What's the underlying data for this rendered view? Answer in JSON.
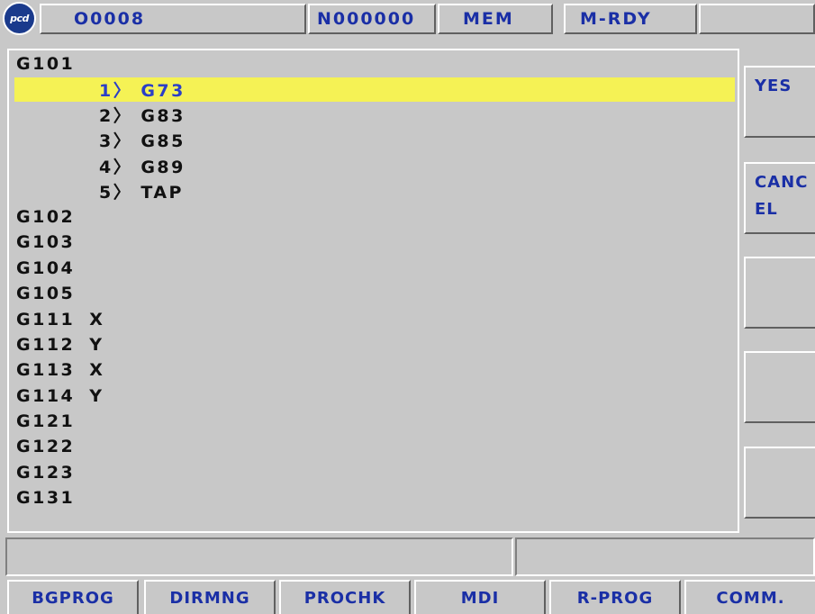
{
  "header": {
    "logo_text": "pcd",
    "program": "O0008",
    "sequence": "N000000",
    "mode": "MEM",
    "status": "M-RDY",
    "extra": ""
  },
  "list": {
    "lines": [
      {
        "code": "G101",
        "arg": ""
      },
      {
        "code": "1〉 G73",
        "arg": "",
        "selected": true
      },
      {
        "code": "2〉 G83",
        "arg": ""
      },
      {
        "code": "3〉 G85",
        "arg": ""
      },
      {
        "code": "4〉 G89",
        "arg": ""
      },
      {
        "code": "5〉 TAP",
        "arg": ""
      },
      {
        "code": "G102",
        "arg": ""
      },
      {
        "code": "G103",
        "arg": ""
      },
      {
        "code": "G104",
        "arg": ""
      },
      {
        "code": "G105",
        "arg": ""
      },
      {
        "code": "G111",
        "arg": "X"
      },
      {
        "code": "G112",
        "arg": "Y"
      },
      {
        "code": "G113",
        "arg": "X"
      },
      {
        "code": "G114",
        "arg": "Y"
      },
      {
        "code": "G121",
        "arg": ""
      },
      {
        "code": "G122",
        "arg": ""
      },
      {
        "code": "G123",
        "arg": ""
      },
      {
        "code": "G131",
        "arg": ""
      }
    ]
  },
  "right_keys": {
    "yes": "YES",
    "cancel_line1": "CANC",
    "cancel_line2": "EL",
    "key3": "",
    "key4": "",
    "key5": ""
  },
  "message": {
    "left": "",
    "right": ""
  },
  "bottom_keys": [
    "BGPROG",
    "DIRMNG",
    "PROCHK",
    "MDI",
    "R-PROG",
    "COMM."
  ],
  "colors": {
    "highlight": "#f5f255",
    "label_blue": "#1a2fa6",
    "panel": "#c8c8c8"
  }
}
